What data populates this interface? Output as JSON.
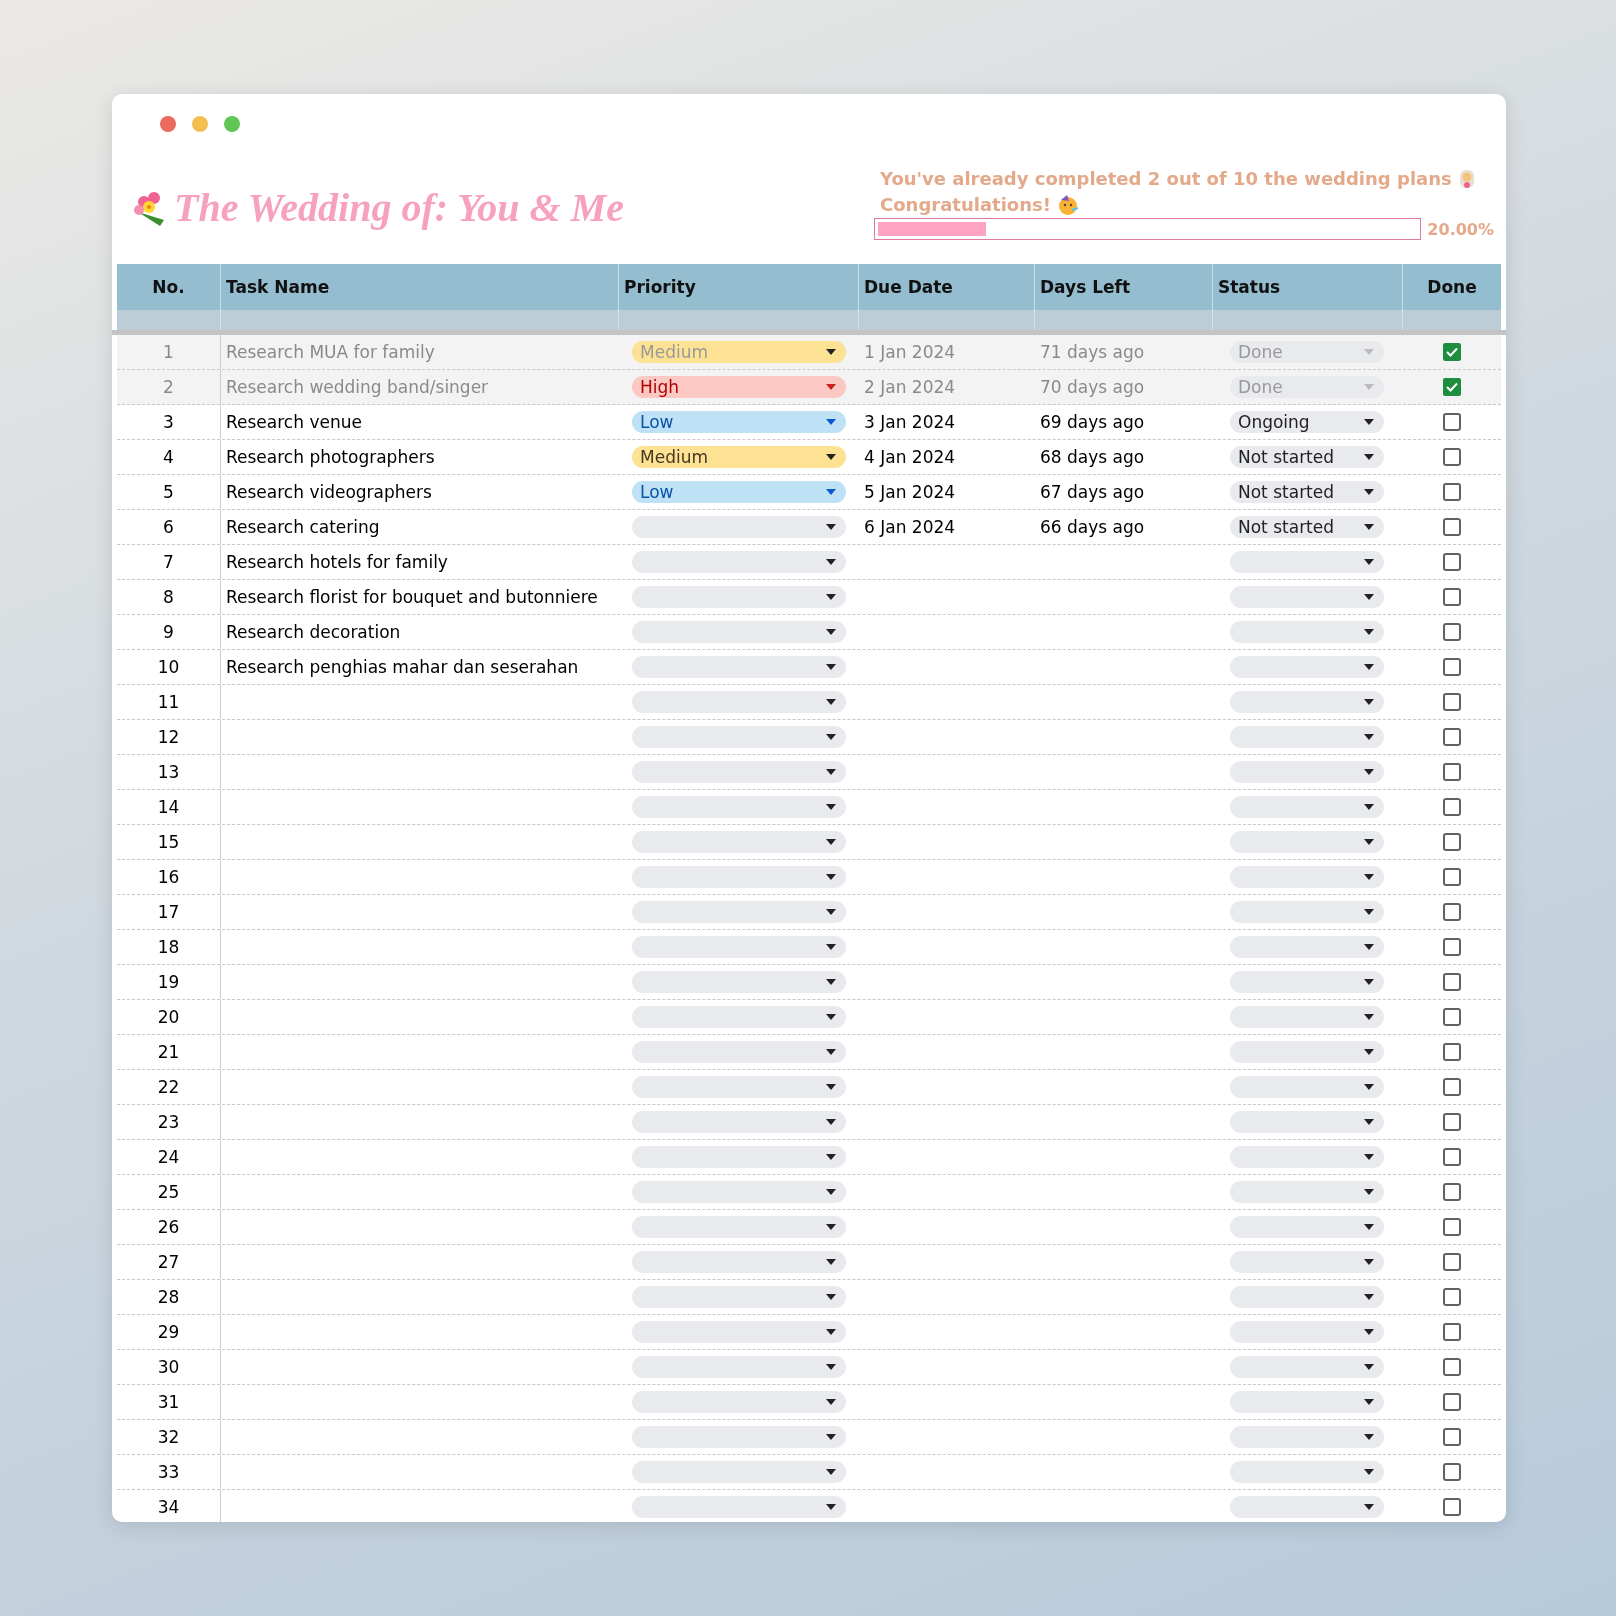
{
  "title": "The Wedding of: You & Me",
  "progress": {
    "message_line_1": "You've already completed 2 out of 10 the wedding plans",
    "message_line_2": "Congratulations!",
    "level": 0.2,
    "percent": "20.00%"
  },
  "columns": [
    "No.",
    "Task Name",
    "Priority",
    "Due Date",
    "Days Left",
    "Status",
    "Done"
  ],
  "rows": [
    {
      "no": "1",
      "task": "Research MUA for family",
      "priority": {
        "label": "Medium",
        "color": "#fde293"
      },
      "due": "1 Jan 2024",
      "days_left": "71 days ago",
      "status": "Done",
      "done": true
    },
    {
      "no": "2",
      "task": "Research wedding band/singer",
      "priority": {
        "label": "High",
        "color": "#fbc8c4"
      },
      "due": "2 Jan 2024",
      "days_left": "70 days ago",
      "status": "Done",
      "done": true
    },
    {
      "no": "3",
      "task": "Research venue",
      "priority": {
        "label": "Low",
        "color": "#bfe1f6"
      },
      "due": "3 Jan 2024",
      "days_left": "69 days ago",
      "status": "Ongoing",
      "done": false
    },
    {
      "no": "4",
      "task": "Research photographers",
      "priority": {
        "label": "Medium",
        "color": "#fde293"
      },
      "due": "4 Jan 2024",
      "days_left": "68 days ago",
      "status": "Not started",
      "done": false
    },
    {
      "no": "5",
      "task": "Research videographers",
      "priority": {
        "label": "Low",
        "color": "#bfe1f6"
      },
      "due": "5 Jan 2024",
      "days_left": "67 days ago",
      "status": "Not started",
      "done": false
    },
    {
      "no": "6",
      "task": "Research catering",
      "due": "6 Jan 2024",
      "days_left": "66 days ago",
      "status": "Not started",
      "done": false
    },
    {
      "no": "7",
      "task": "Research hotels for family",
      "done": false
    },
    {
      "no": "8",
      "task": "Research florist for bouquet and butonniere",
      "done": false
    },
    {
      "no": "9",
      "task": "Research decoration",
      "done": false
    },
    {
      "no": "10",
      "task": "Research penghias mahar dan seserahan",
      "done": false
    },
    {
      "no": "11",
      "done": false
    },
    {
      "no": "12",
      "done": false
    },
    {
      "no": "13",
      "done": false
    },
    {
      "no": "14",
      "done": false
    },
    {
      "no": "15",
      "done": false
    },
    {
      "no": "16",
      "done": false
    },
    {
      "no": "17",
      "done": false
    },
    {
      "no": "18",
      "done": false
    },
    {
      "no": "19",
      "done": false
    },
    {
      "no": "20",
      "done": false
    },
    {
      "no": "21",
      "done": false
    },
    {
      "no": "22",
      "done": false
    },
    {
      "no": "23",
      "done": false
    },
    {
      "no": "24",
      "done": false
    },
    {
      "no": "25",
      "done": false
    },
    {
      "no": "26",
      "done": false
    },
    {
      "no": "27",
      "done": false
    },
    {
      "no": "28",
      "done": false
    },
    {
      "no": "29",
      "done": false
    },
    {
      "no": "30",
      "done": false
    },
    {
      "no": "31",
      "done": false
    },
    {
      "no": "32",
      "done": false
    },
    {
      "no": "33",
      "done": false
    },
    {
      "no": "34",
      "done": false
    }
  ]
}
